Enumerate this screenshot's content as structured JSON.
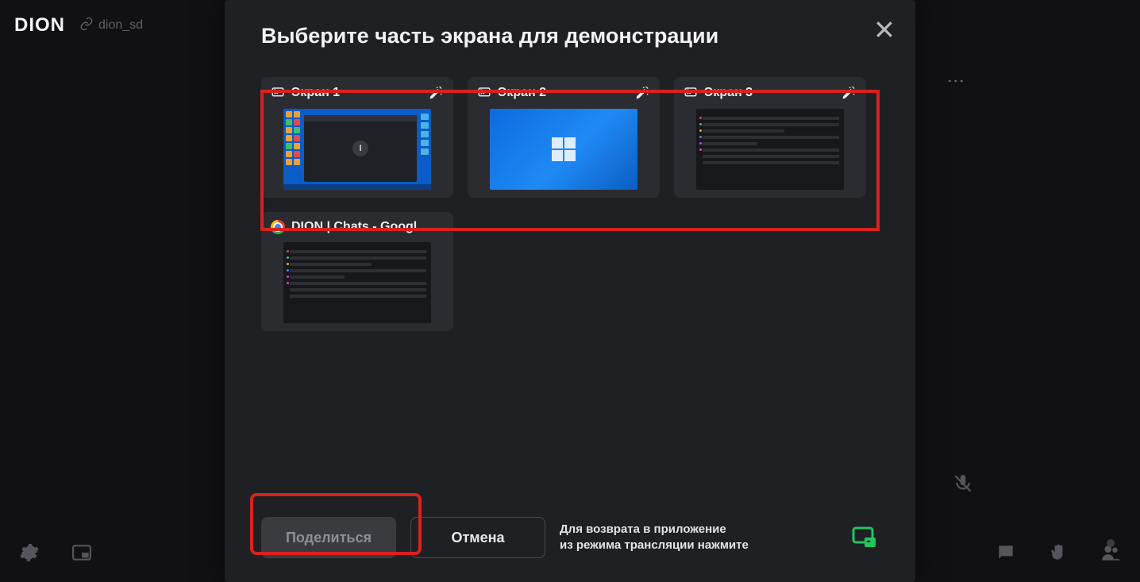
{
  "bg": {
    "app_name": "DION",
    "room_code": "dion_sd"
  },
  "modal": {
    "title": "Выберите часть экрана для демонстрации",
    "screens": [
      {
        "label": "Экран 1",
        "icon": "monitor-icon",
        "wand": true
      },
      {
        "label": "Экран 2",
        "icon": "monitor-icon",
        "wand": true
      },
      {
        "label": "Экран 3",
        "icon": "monitor-icon",
        "wand": true
      }
    ],
    "windows": [
      {
        "label": "DION | Chats - Googl…",
        "icon": "chrome-icon"
      }
    ],
    "buttons": {
      "share": "Поделиться",
      "cancel": "Отмена"
    },
    "hint_line1": "Для возврата в приложение",
    "hint_line2": "из режима трансляции нажмите"
  }
}
